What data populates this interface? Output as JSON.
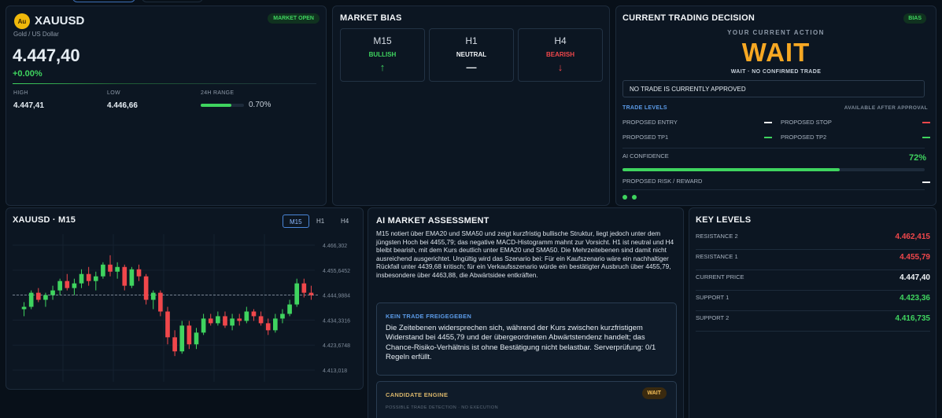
{
  "ticker": {
    "badge": "Au",
    "symbol": "XAUUSD",
    "subtitle": "Gold / US Dollar",
    "status": "MARKET OPEN",
    "price": "4.447,40",
    "change": "+0.00%",
    "high_label": "HIGH",
    "high": "4.447,41",
    "low_label": "LOW",
    "low": "4.446,66",
    "range_label": "24H RANGE",
    "range_pct": "0.70%",
    "range_fill": 0.7
  },
  "bias": {
    "title": "MARKET BIAS",
    "frames": [
      {
        "tf": "M15",
        "state": "BULLISH",
        "icon": "↑",
        "color": "#3fd45f"
      },
      {
        "tf": "H1",
        "state": "NEUTRAL",
        "icon": "—",
        "color": "#f2f5f8"
      },
      {
        "tf": "H4",
        "state": "BEARISH",
        "icon": "↓",
        "color": "#f0474b"
      }
    ]
  },
  "decision": {
    "title": "CURRENT TRADING DECISION",
    "badge": "BIAS",
    "action_label": "YOUR CURRENT ACTION",
    "action": "WAIT",
    "action_sub": "WAIT · NO CONFIRMED TRADE",
    "notice": "NO TRADE IS CURRENTLY APPROVED",
    "levels_head": "TRADE LEVELS",
    "levels_after": "AVAILABLE AFTER APPROVAL",
    "entry": "PROPOSED ENTRY",
    "stop": "PROPOSED STOP",
    "tp1": "PROPOSED TP1",
    "tp2": "PROPOSED TP2",
    "confidence_label": "AI CONFIDENCE",
    "confidence": "72%",
    "confidence_value": 0.72,
    "rr_label": "PROPOSED RISK / REWARD"
  },
  "chart": {
    "title": "XAUUSD · M15",
    "tabs": [
      "M15",
      "H1",
      "H4"
    ],
    "active_tab": "M15"
  },
  "chart_data": {
    "type": "candlestick",
    "y_ticks": [
      "4.466,302",
      "4.455,6452",
      "4.444,9884",
      "4.434,3316",
      "4.423,6748",
      "4.413,018"
    ],
    "ylim": [
      4408,
      4471
    ],
    "current_price": 4444.9884,
    "candles": [
      {
        "o": 4439,
        "h": 4442,
        "l": 4436,
        "c": 4440
      },
      {
        "o": 4440,
        "h": 4447,
        "l": 4439,
        "c": 4446
      },
      {
        "o": 4446,
        "h": 4448,
        "l": 4442,
        "c": 4443
      },
      {
        "o": 4443,
        "h": 4446,
        "l": 4440,
        "c": 4445
      },
      {
        "o": 4445,
        "h": 4449,
        "l": 4443,
        "c": 4447
      },
      {
        "o": 4447,
        "h": 4452,
        "l": 4445,
        "c": 4451
      },
      {
        "o": 4451,
        "h": 4454,
        "l": 4447,
        "c": 4448
      },
      {
        "o": 4448,
        "h": 4452,
        "l": 4445,
        "c": 4450
      },
      {
        "o": 4450,
        "h": 4456,
        "l": 4448,
        "c": 4454
      },
      {
        "o": 4454,
        "h": 4457,
        "l": 4449,
        "c": 4451
      },
      {
        "o": 4451,
        "h": 4455,
        "l": 4447,
        "c": 4453
      },
      {
        "o": 4453,
        "h": 4459,
        "l": 4452,
        "c": 4458
      },
      {
        "o": 4458,
        "h": 4462,
        "l": 4453,
        "c": 4455
      },
      {
        "o": 4455,
        "h": 4459,
        "l": 4452,
        "c": 4457
      },
      {
        "o": 4457,
        "h": 4458,
        "l": 4447,
        "c": 4449
      },
      {
        "o": 4449,
        "h": 4457,
        "l": 4448,
        "c": 4456
      },
      {
        "o": 4456,
        "h": 4458,
        "l": 4451,
        "c": 4453
      },
      {
        "o": 4453,
        "h": 4454,
        "l": 4441,
        "c": 4443
      },
      {
        "o": 4443,
        "h": 4447,
        "l": 4439,
        "c": 4446
      },
      {
        "o": 4446,
        "h": 4447,
        "l": 4436,
        "c": 4438
      },
      {
        "o": 4438,
        "h": 4440,
        "l": 4424,
        "c": 4427
      },
      {
        "o": 4427,
        "h": 4430,
        "l": 4419,
        "c": 4421
      },
      {
        "o": 4421,
        "h": 4434,
        "l": 4420,
        "c": 4432
      },
      {
        "o": 4432,
        "h": 4434,
        "l": 4422,
        "c": 4424
      },
      {
        "o": 4424,
        "h": 4431,
        "l": 4422,
        "c": 4429
      },
      {
        "o": 4429,
        "h": 4437,
        "l": 4428,
        "c": 4435
      },
      {
        "o": 4435,
        "h": 4437,
        "l": 4432,
        "c": 4433
      },
      {
        "o": 4433,
        "h": 4438,
        "l": 4432,
        "c": 4436
      },
      {
        "o": 4436,
        "h": 4438,
        "l": 4431,
        "c": 4432
      },
      {
        "o": 4432,
        "h": 4437,
        "l": 4430,
        "c": 4435
      },
      {
        "o": 4435,
        "h": 4437,
        "l": 4432,
        "c": 4434
      },
      {
        "o": 4434,
        "h": 4440,
        "l": 4433,
        "c": 4438
      },
      {
        "o": 4438,
        "h": 4439,
        "l": 4434,
        "c": 4436
      },
      {
        "o": 4436,
        "h": 4438,
        "l": 4432,
        "c": 4433
      },
      {
        "o": 4433,
        "h": 4435,
        "l": 4428,
        "c": 4430
      },
      {
        "o": 4430,
        "h": 4437,
        "l": 4429,
        "c": 4435
      },
      {
        "o": 4435,
        "h": 4439,
        "l": 4433,
        "c": 4437
      },
      {
        "o": 4437,
        "h": 4443,
        "l": 4436,
        "c": 4441
      },
      {
        "o": 4441,
        "h": 4452,
        "l": 4440,
        "c": 4450
      },
      {
        "o": 4450,
        "h": 4452,
        "l": 4444,
        "c": 4446
      },
      {
        "o": 4446,
        "h": 4449,
        "l": 4443,
        "c": 4445
      }
    ]
  },
  "ai": {
    "title": "AI MARKET ASSESSMENT",
    "text": "M15 notiert über EMA20 und SMA50 und zeigt kurzfristig bullische Struktur, liegt jedoch unter dem jüngsten Hoch bei 4455,79; das negative MACD-Histogramm mahnt zur Vorsicht. H1 ist neutral und H4 bleibt bearish, mit dem Kurs deutlich unter EMA20 und SMA50. Die Mehrzeitebenen sind damit nicht ausreichend ausgerichtet. Ungültig wird das Szenario bei: Für ein Kaufszenario wäre ein nachhaltiger Rückfall unter 4439,68 kritisch; für ein Verkaufsszenario würde ein bestätigter Ausbruch über 4455,79, insbesondere über 4463,88, die Abwärtsidee entkräften.",
    "box_title": "KEIN TRADE FREIGEGEBEN",
    "box_text": "Die Zeitebenen widersprechen sich, während der Kurs zwischen kurzfristigem Widerstand bei 4455,79 und der übergeordneten Abwärtstendenz handelt; das Chance-Risiko-Verhältnis ist ohne Bestätigung nicht belastbar. Serverprüfung: 0/1 Regeln erfüllt.",
    "engine_title": "CANDIDATE ENGINE",
    "engine_badge": "WAIT",
    "engine_sub": "POSSIBLE TRADE DETECTION · NO EXECUTION"
  },
  "levels": {
    "title": "KEY LEVELS",
    "rows": [
      {
        "label": "RESISTANCE 2",
        "value": "4.462,415",
        "color": "#f0474b"
      },
      {
        "label": "RESISTANCE 1",
        "value": "4.455,79",
        "color": "#f0474b"
      },
      {
        "label": "CURRENT PRICE",
        "value": "4.447,40",
        "color": "#f2f5f8"
      },
      {
        "label": "SUPPORT 1",
        "value": "4.423,36",
        "color": "#3fd45f"
      },
      {
        "label": "SUPPORT 2",
        "value": "4.416,735",
        "color": "#3fd45f"
      }
    ]
  },
  "colors": {
    "up": "#3fd45f",
    "down": "#f0474b",
    "accent": "#f7a823"
  }
}
